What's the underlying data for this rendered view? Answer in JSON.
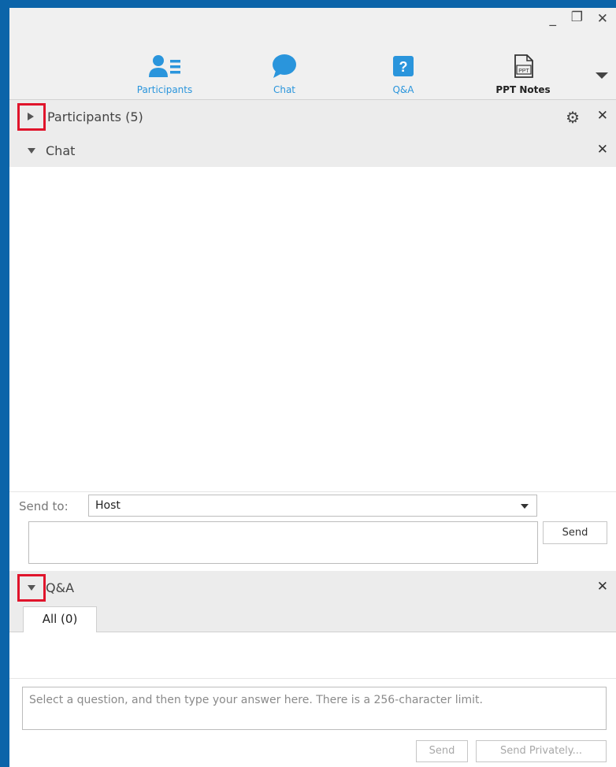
{
  "window": {
    "controls": {
      "minimize": "_",
      "restore": "❐",
      "close": "✕"
    }
  },
  "tabs": [
    {
      "label": "Participants",
      "icon": "participants-icon",
      "color": "#2a95dc"
    },
    {
      "label": "Chat",
      "icon": "chat-bubble-icon",
      "color": "#2a95dc"
    },
    {
      "label": "Q&A",
      "icon": "question-icon",
      "color": "#2a95dc"
    },
    {
      "label": "PPT Notes",
      "icon": "ppt-notes-icon",
      "color": "#222222"
    }
  ],
  "ppt_icon_text": "PPT",
  "participants_panel": {
    "title": "Participants (5)",
    "collapsed": true
  },
  "chat_panel": {
    "title": "Chat",
    "send_to_label": "Send to:",
    "send_to_value": "Host",
    "send_button": "Send"
  },
  "qa_panel": {
    "title": "Q&A",
    "tab_all": "All (0)",
    "answer_placeholder": "Select a question, and then type your answer here. There is a 256-character limit.",
    "send_button": "Send",
    "send_privately_button": "Send Privately..."
  },
  "colors": {
    "accent": "#2a95dc",
    "highlight": "#e0142b",
    "frame": "#0b64a9"
  }
}
